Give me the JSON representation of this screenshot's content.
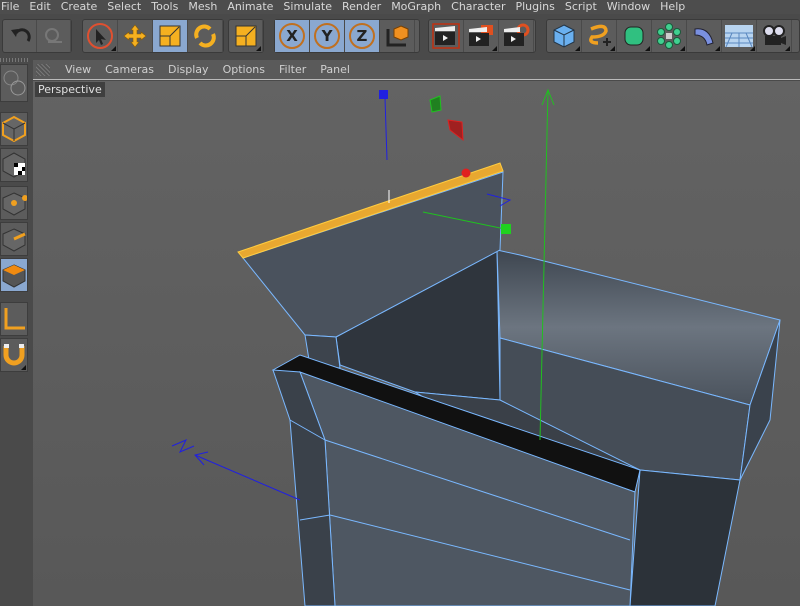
{
  "menu": [
    "File",
    "Edit",
    "Create",
    "Select",
    "Tools",
    "Mesh",
    "Animate",
    "Simulate",
    "Render",
    "MoGraph",
    "Character",
    "Plugins",
    "Script",
    "Window",
    "Help"
  ],
  "toolbar": {
    "icons": [
      "undo-icon",
      "redo-icon",
      "live-selection-icon",
      "move-icon",
      "scale-icon",
      "rotate-icon",
      "recent-tool-icon",
      "x-axis-lock-icon",
      "y-axis-lock-icon",
      "z-axis-lock-icon",
      "coordinate-system-icon",
      "render-view-icon",
      "render-to-picture-viewer-icon",
      "render-settings-icon",
      "cube-icon",
      "spline-pen-icon",
      "subdivision-surface-icon",
      "cloner-icon",
      "deformer-bend-icon",
      "floor-icon",
      "camera-icon"
    ],
    "axis_labels": [
      "X",
      "Y",
      "Z"
    ]
  },
  "viewport": {
    "menu": [
      "View",
      "Cameras",
      "Display",
      "Options",
      "Filter",
      "Panel"
    ],
    "camera_label": "Perspective"
  },
  "colors": {
    "accent_orange": "#f0a020",
    "selection_blue": "#8aa8d0",
    "axis_x": "#e02020",
    "axis_y": "#20c020",
    "axis_z": "#2020e0",
    "wire": "#7ab8ff"
  }
}
